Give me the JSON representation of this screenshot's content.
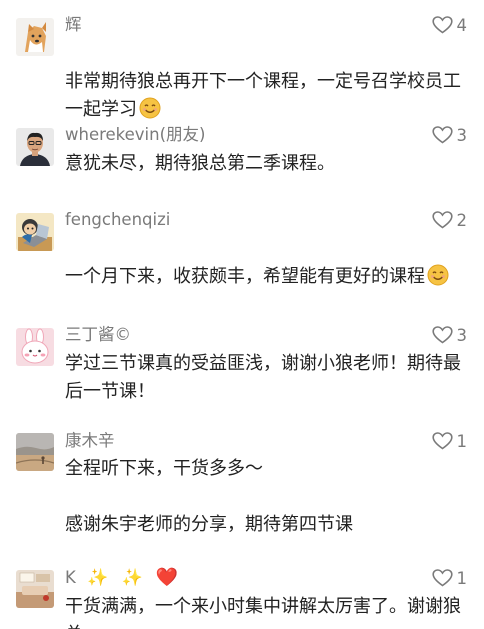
{
  "comments": [
    {
      "name": "辉",
      "likes": "4",
      "text": "非常期待狼总再开下一个课程，一定号召学校员工一起学习",
      "avatar_icon": "shiba-dog-avatar",
      "trailing_emoji": "smile-emoji"
    },
    {
      "name": "wherekevin(朋友)",
      "likes": "3",
      "text": "意犹未尽，期待狼总第二季课程。",
      "avatar_icon": "man-portrait-avatar"
    },
    {
      "name": "fengchenqizi",
      "likes": "2",
      "text": "一个月下来，收获颇丰，希望能有更好的课程",
      "avatar_icon": "cartoon-laptop-avatar",
      "trailing_emoji": "smile-emoji"
    },
    {
      "name": "三丁酱©",
      "likes": "3",
      "text": "学过三节课真的受益匪浅，谢谢小狼老师！期待最后一节课！",
      "avatar_icon": "pink-bunny-avatar"
    },
    {
      "name": "康木辛",
      "likes": "1",
      "text": "全程听下来，干货多多～\n\n感谢朱宇老师的分享，期待第四节课",
      "avatar_icon": "landscape-avatar"
    },
    {
      "name": "K",
      "name_emojis": [
        "✨",
        "✨",
        "❤️"
      ],
      "likes": "1",
      "text": "干货满满，一个来小时集中讲解太厉害了。谢谢狼总",
      "avatar_icon": "warm-room-avatar"
    }
  ],
  "colors": {
    "name": "#7a7a7a",
    "text": "#222222",
    "heart": "#e8202a",
    "sparkle": "#f5c518"
  }
}
